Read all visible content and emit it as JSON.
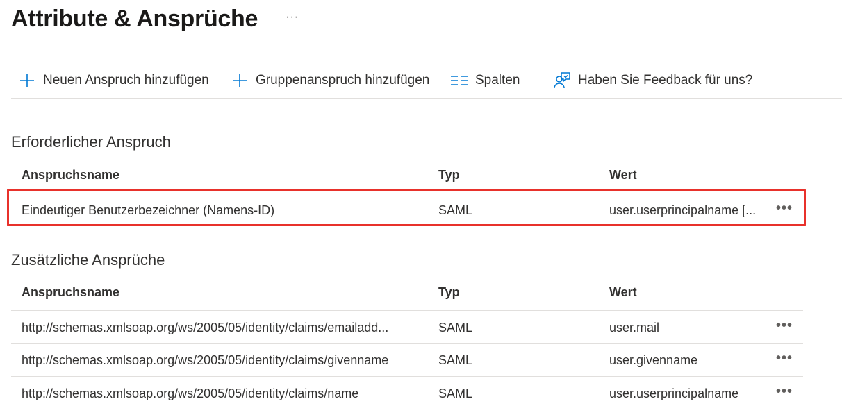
{
  "page": {
    "title": "Attribute & Ansprüche",
    "more_label": "···"
  },
  "toolbar": {
    "add_claim": {
      "label": "Neuen Anspruch hinzufügen",
      "icon": "plus-icon"
    },
    "add_group_claim": {
      "label": "Gruppenanspruch hinzufügen",
      "icon": "plus-icon"
    },
    "columns": {
      "label": "Spalten",
      "icon": "columns-icon"
    },
    "feedback": {
      "label": "Haben Sie Feedback für uns?",
      "icon": "feedback-icon"
    }
  },
  "colors": {
    "accent": "#0078d4",
    "highlight": "#e8312b"
  },
  "required": {
    "title": "Erforderlicher Anspruch",
    "headers": {
      "name": "Anspruchsname",
      "type": "Typ",
      "value": "Wert"
    },
    "rows": [
      {
        "name": "Eindeutiger Benutzerbezeichner (Namens-ID)",
        "type": "SAML",
        "value": "user.userprincipalname [...",
        "more": "•••"
      }
    ]
  },
  "additional": {
    "title": "Zusätzliche Ansprüche",
    "headers": {
      "name": "Anspruchsname",
      "type": "Typ",
      "value": "Wert"
    },
    "rows": [
      {
        "name": "http://schemas.xmlsoap.org/ws/2005/05/identity/claims/emailadd...",
        "type": "SAML",
        "value": "user.mail",
        "more": "•••"
      },
      {
        "name": "http://schemas.xmlsoap.org/ws/2005/05/identity/claims/givenname",
        "type": "SAML",
        "value": "user.givenname",
        "more": "•••"
      },
      {
        "name": "http://schemas.xmlsoap.org/ws/2005/05/identity/claims/name",
        "type": "SAML",
        "value": "user.userprincipalname",
        "more": "•••"
      }
    ]
  }
}
